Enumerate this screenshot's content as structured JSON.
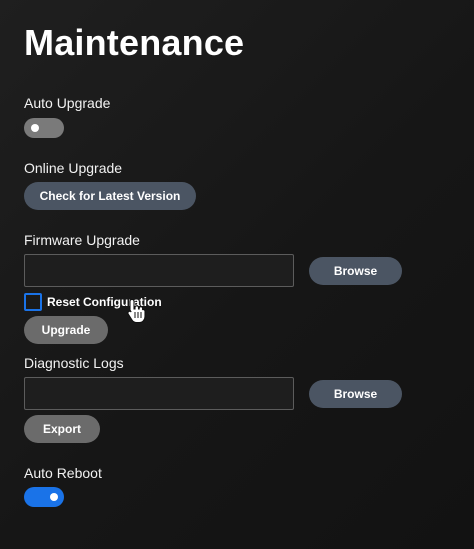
{
  "page": {
    "title": "Maintenance"
  },
  "auto_upgrade": {
    "label": "Auto Upgrade",
    "enabled": false
  },
  "online_upgrade": {
    "label": "Online Upgrade",
    "button_label": "Check for Latest Version"
  },
  "firmware_upgrade": {
    "label": "Firmware Upgrade",
    "file_value": "",
    "browse_label": "Browse",
    "reset_config_label": "Reset Configuration",
    "reset_config_checked": false,
    "upgrade_label": "Upgrade"
  },
  "diagnostic_logs": {
    "label": "Diagnostic Logs",
    "file_value": "",
    "browse_label": "Browse",
    "export_label": "Export"
  },
  "auto_reboot": {
    "label": "Auto Reboot",
    "enabled": true
  },
  "icons": {
    "cursor": "hand-pointer-icon"
  },
  "colors": {
    "accent": "#1a73e8",
    "primary_button": "#4b5563",
    "secondary_button": "#6b6b6b",
    "toggle_off": "#7a7a7a",
    "background": "#1a1a1a"
  }
}
